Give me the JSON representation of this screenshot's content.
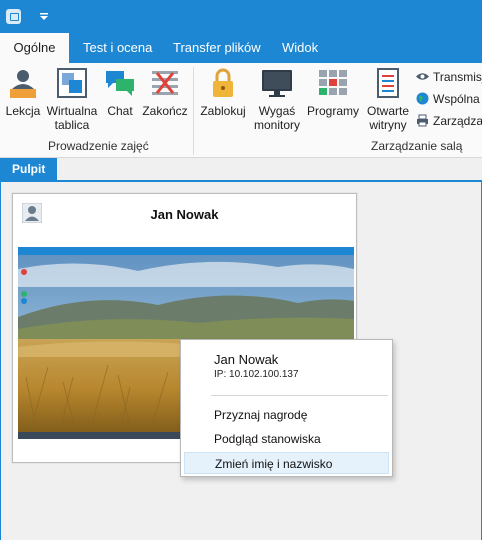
{
  "titlebar": {
    "app_icon": "app-icon",
    "quick_access": "dropdown-arrow-icon"
  },
  "tabs": [
    {
      "label": "Ogólne",
      "active": true
    },
    {
      "label": "Test i ocena",
      "active": false
    },
    {
      "label": "Transfer plików",
      "active": false
    },
    {
      "label": "Widok",
      "active": false
    }
  ],
  "ribbon": {
    "group1": {
      "label": "Prowadzenie zajęć",
      "buttons": [
        {
          "label": "Lekcja",
          "icon": "teacher-icon"
        },
        {
          "label": "Wirtualna tablica",
          "icon": "whiteboard-icon"
        },
        {
          "label": "Chat",
          "icon": "chat-icon"
        },
        {
          "label": "Zakończ",
          "icon": "end-icon"
        }
      ]
    },
    "group2": {
      "label": "Zarządzanie salą",
      "buttons": [
        {
          "label": "Zablokuj",
          "icon": "lock-icon"
        },
        {
          "label": "Wygaś monitory",
          "icon": "monitor-icon"
        },
        {
          "label": "Programy",
          "icon": "programs-icon"
        },
        {
          "label": "Otwarte witryny",
          "icon": "websites-icon"
        }
      ],
      "small_buttons": [
        {
          "label": "Transmisj",
          "icon": "eye-icon"
        },
        {
          "label": "Wspólna",
          "icon": "globe-icon"
        },
        {
          "label": "Zarządza",
          "icon": "printer-icon"
        }
      ]
    }
  },
  "subtab": {
    "label": "Pulpit"
  },
  "card": {
    "name": "Jan Nowak",
    "avatar_icon": "user-icon"
  },
  "context_menu": {
    "title": "Jan Nowak",
    "ip": "IP: 10.102.100.137",
    "items": [
      {
        "label": "Przyznaj nagrodę"
      },
      {
        "label": "Podgląd stanowiska"
      },
      {
        "label": "Zmień imię i nazwisko",
        "highlighted": true
      }
    ]
  },
  "colors": {
    "accent": "#1e87d3",
    "ribbon_bg": "#fafafa",
    "workspace_bg": "#f0f0f0"
  }
}
